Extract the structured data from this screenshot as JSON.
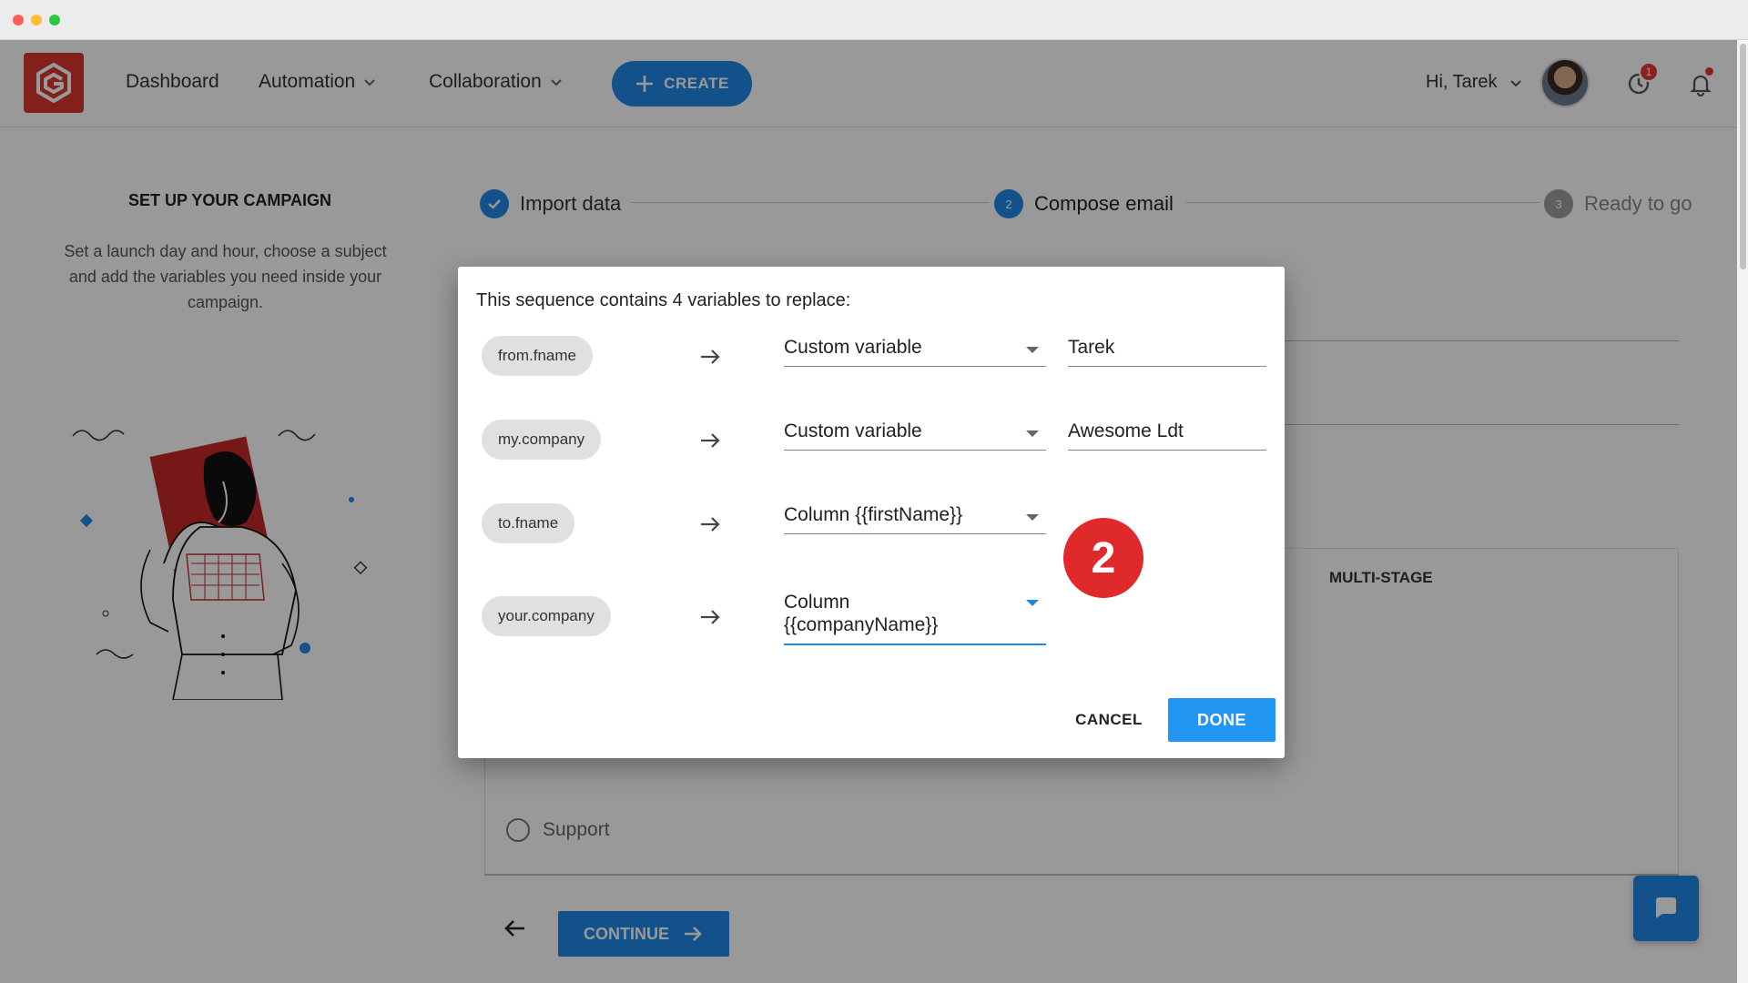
{
  "header": {
    "nav": [
      {
        "label": "Dashboard"
      },
      {
        "label": "Automation"
      },
      {
        "label": "Collaboration"
      }
    ],
    "create_label": "CREATE",
    "greeting": "Hi, Tarek",
    "history_badge": "1"
  },
  "left_panel": {
    "title": "SET UP YOUR CAMPAIGN",
    "description": "Set a launch day and hour, choose a subject and add the variables you need inside your campaign."
  },
  "stepper": [
    {
      "label": "Import data",
      "number": "",
      "state": "done"
    },
    {
      "label": "Compose email",
      "number": "2",
      "state": "active"
    },
    {
      "label": "Ready to go",
      "number": "3",
      "state": "pending"
    }
  ],
  "background": {
    "multistage_label": "MULTI-STAGE",
    "support_label": "Support",
    "continue_label": "CONTINUE"
  },
  "dialog": {
    "title": "This sequence contains 4 variables to replace:",
    "rows": [
      {
        "variable": "from.fname",
        "mapping": "Custom variable",
        "value": "Tarek"
      },
      {
        "variable": "my.company",
        "mapping": "Custom variable",
        "value": "Awesome Ldt"
      },
      {
        "variable": "to.fname",
        "mapping": "Column {{firstName}}",
        "value": ""
      },
      {
        "variable": "your.company",
        "mapping": "Column {{companyName}}",
        "value": ""
      }
    ],
    "cancel_label": "CANCEL",
    "done_label": "DONE"
  },
  "annotation_badge": "2",
  "colors": {
    "brand_red": "#d9382f",
    "primary_blue": "#1e88e5",
    "annotation_red": "#e0292b"
  }
}
